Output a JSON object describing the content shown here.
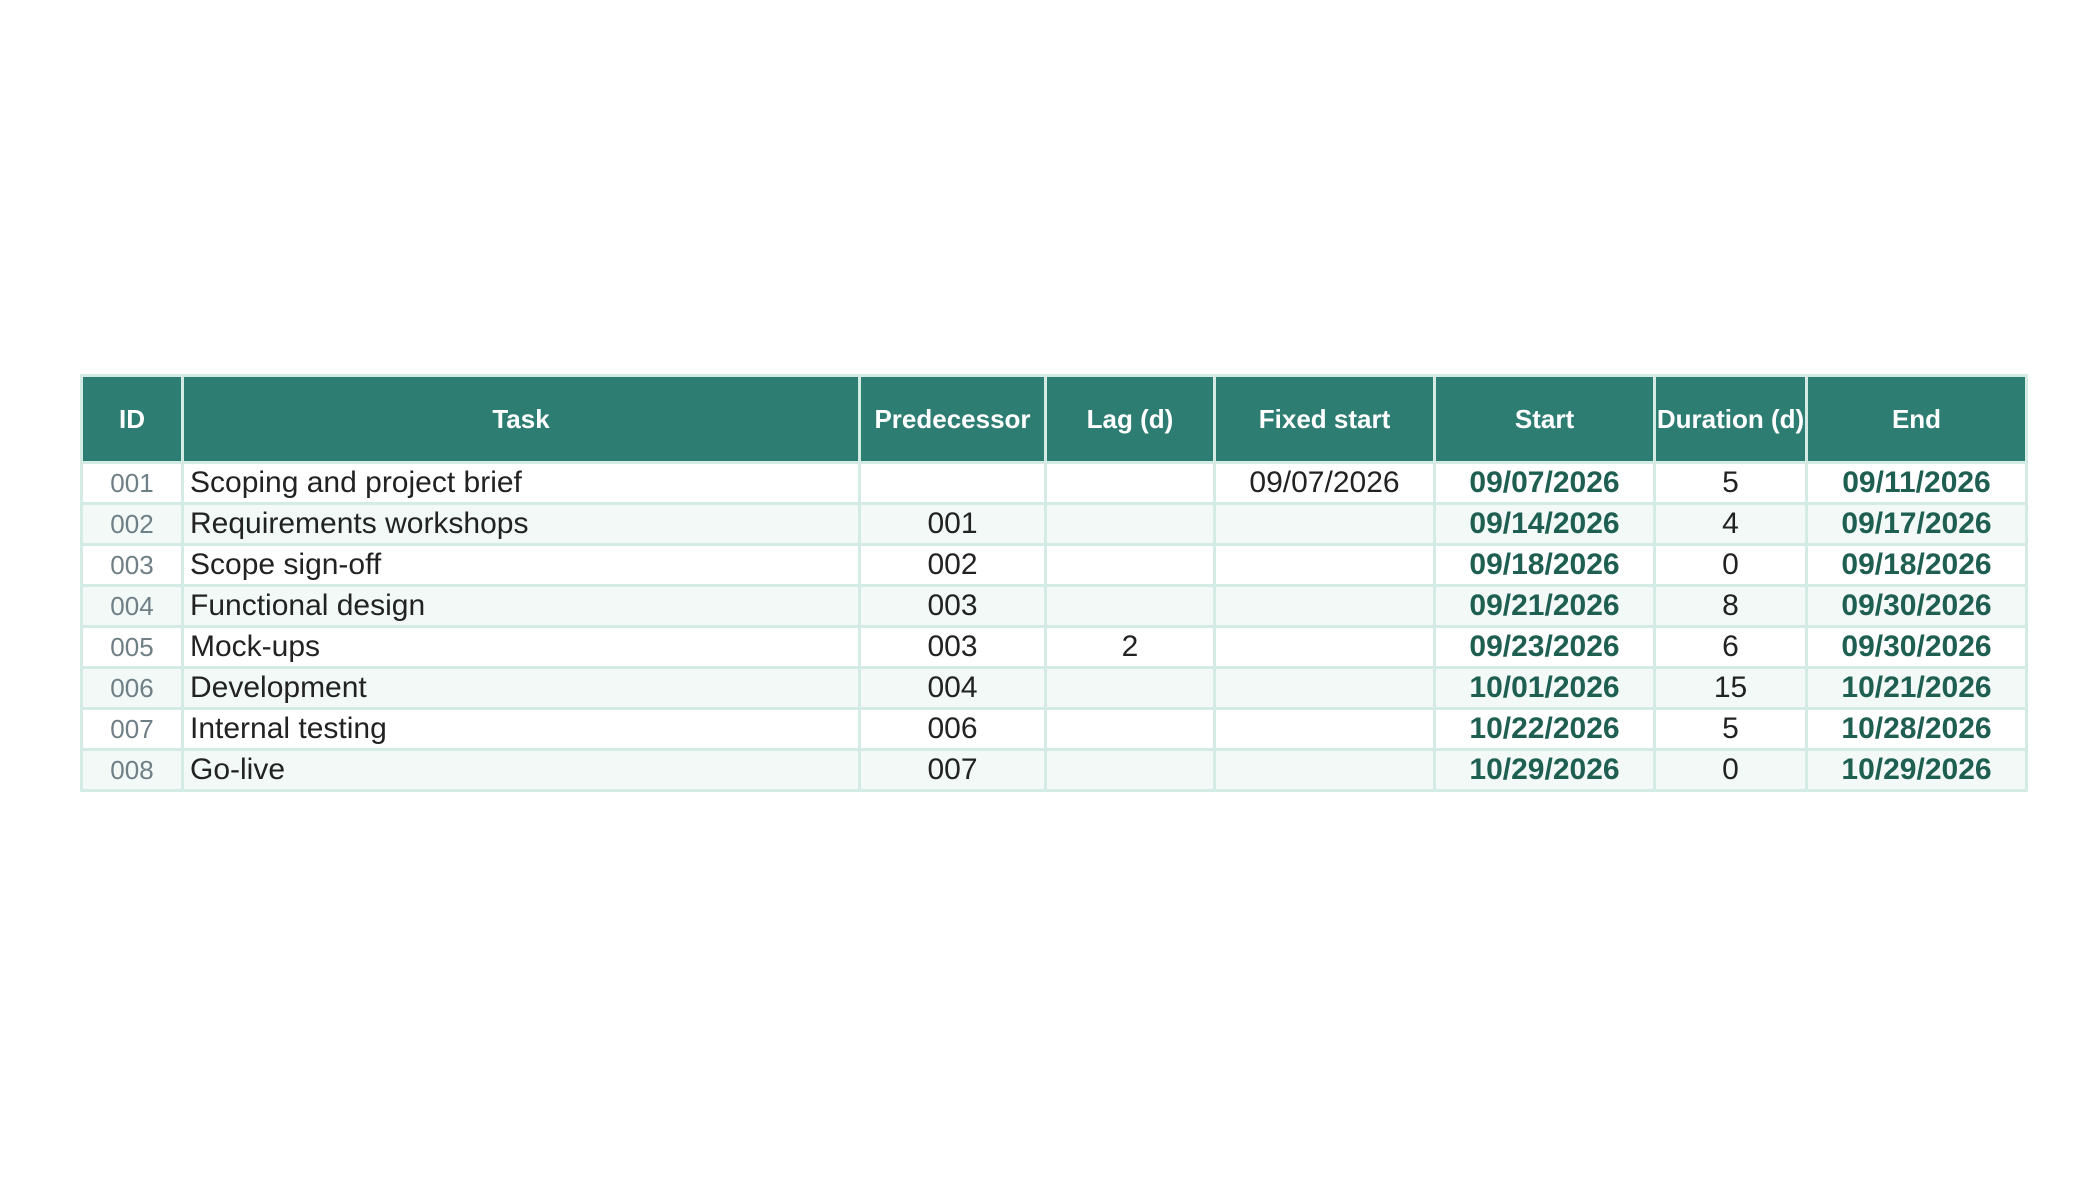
{
  "table": {
    "headers": {
      "id": "ID",
      "task": "Task",
      "predecessor": "Predecessor",
      "lag": "Lag (d)",
      "fixed_start": "Fixed start",
      "start": "Start",
      "duration": "Duration (d)",
      "end": "End"
    },
    "rows": [
      {
        "id": "001",
        "task": "Scoping and project brief",
        "predecessor": "",
        "lag": "",
        "fixed_start": "09/07/2026",
        "start": "09/07/2026",
        "duration": "5",
        "end": "09/11/2026"
      },
      {
        "id": "002",
        "task": "Requirements workshops",
        "predecessor": "001",
        "lag": "",
        "fixed_start": "",
        "start": "09/14/2026",
        "duration": "4",
        "end": "09/17/2026"
      },
      {
        "id": "003",
        "task": "Scope sign-off",
        "predecessor": "002",
        "lag": "",
        "fixed_start": "",
        "start": "09/18/2026",
        "duration": "0",
        "end": "09/18/2026"
      },
      {
        "id": "004",
        "task": "Functional design",
        "predecessor": "003",
        "lag": "",
        "fixed_start": "",
        "start": "09/21/2026",
        "duration": "8",
        "end": "09/30/2026"
      },
      {
        "id": "005",
        "task": "Mock-ups",
        "predecessor": "003",
        "lag": "2",
        "fixed_start": "",
        "start": "09/23/2026",
        "duration": "6",
        "end": "09/30/2026"
      },
      {
        "id": "006",
        "task": "Development",
        "predecessor": "004",
        "lag": "",
        "fixed_start": "",
        "start": "10/01/2026",
        "duration": "15",
        "end": "10/21/2026"
      },
      {
        "id": "007",
        "task": "Internal testing",
        "predecessor": "006",
        "lag": "",
        "fixed_start": "",
        "start": "10/22/2026",
        "duration": "5",
        "end": "10/28/2026"
      },
      {
        "id": "008",
        "task": "Go-live",
        "predecessor": "007",
        "lag": "",
        "fixed_start": "",
        "start": "10/29/2026",
        "duration": "0",
        "end": "10/29/2026"
      }
    ]
  },
  "colors": {
    "header_bg": "#2e7d72",
    "header_text": "#ffffff",
    "grid_line": "#d4eae4",
    "row_alt_bg": "#f2f9f7",
    "computed_date_text": "#1f5f52",
    "id_text": "#6f7f86"
  }
}
